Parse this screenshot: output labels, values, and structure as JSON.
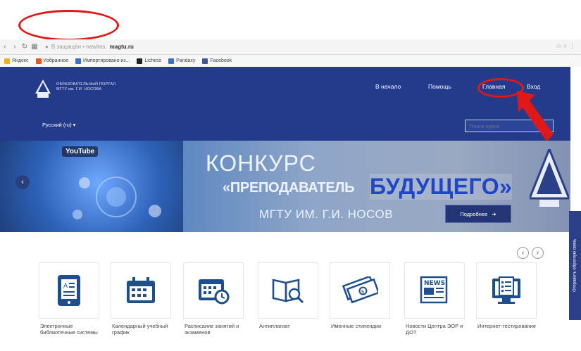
{
  "browser": {
    "url_prefix": "В защищён • newlms.",
    "url_host": "magtu.ru",
    "right_controls": "☆ ○ ⋮",
    "bookmarks": [
      {
        "label": "Яндекс",
        "color": "#f2b21b"
      },
      {
        "label": "Избранное",
        "color": "#e05a1c"
      },
      {
        "label": "Импортировано из...",
        "color": "#3a6ed0"
      },
      {
        "label": "Lichess",
        "color": "#222222"
      },
      {
        "label": "Pandaxy",
        "color": "#3a6ed0"
      },
      {
        "label": "Facebook",
        "color": "#3b5998"
      }
    ]
  },
  "header": {
    "logo_text": "ОБРАЗОВАТЕЛЬНЫЙ ПОРТАЛ МГТУ им. Г.И. НОСОВА",
    "nav": {
      "home": "В начало",
      "help": "Помощь",
      "main": "Главная",
      "login": "Вход"
    },
    "language": "Русский (ru) ▾",
    "search_placeholder": "Поиск курса"
  },
  "banner": {
    "youtube": "YouTube",
    "line1": "КОНКУРС",
    "line2a": "«ПРЕПОДАВАТЕЛЬ",
    "line2b": "БУДУЩЕГО»",
    "line3": "МГТУ ИМ. Г.И. НОСОВ",
    "details_button": "Подробнее"
  },
  "side_tab": "Отправить обратную связь",
  "tiles": [
    {
      "label": "Электронные библиотечные системы",
      "icon": "ebook-icon"
    },
    {
      "label": "Календарный учебный график",
      "icon": "calendar-icon"
    },
    {
      "label": "Расписание занятий и экзаменов",
      "icon": "schedule-icon"
    },
    {
      "label": "Антиплагиат",
      "icon": "book-search-icon"
    },
    {
      "label": "Именные стипендии",
      "icon": "money-icon"
    },
    {
      "label": "Новости Центра ЭОР и ДОТ",
      "icon": "news-icon"
    },
    {
      "label": "Интернет-тестирование",
      "icon": "testing-icon"
    }
  ],
  "carousel": {
    "prev": "‹",
    "next": "›"
  }
}
